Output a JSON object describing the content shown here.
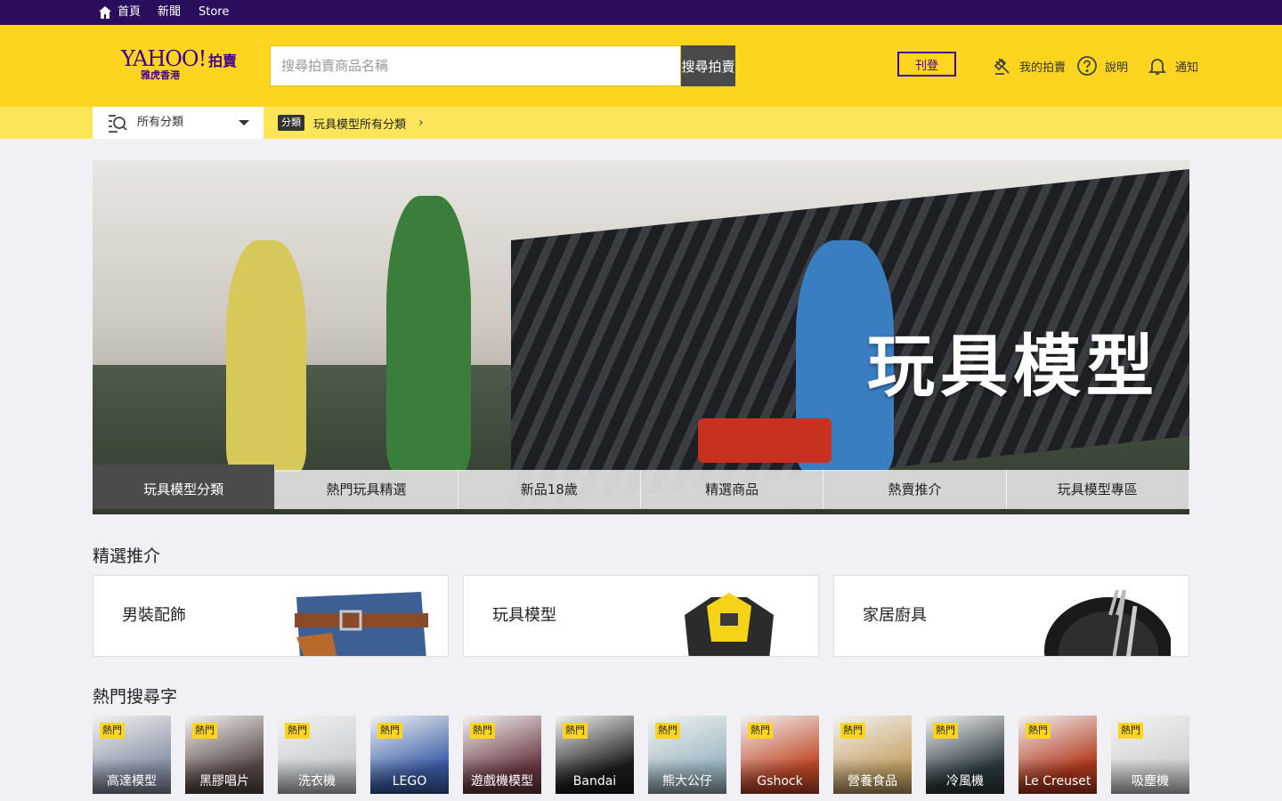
{
  "topbar": {
    "home_label": "首頁",
    "news_label": "新聞",
    "store_label": "Store"
  },
  "header": {
    "logo_text": "YAHOO!",
    "logo_auction": "拍賣",
    "logo_region": "雅虎香港",
    "search_placeholder": "搜尋拍賣商品名稱",
    "search_button": "搜尋拍賣",
    "sell_button": "刊登",
    "my_auction_label": "我的拍賣",
    "help_label": "說明",
    "notify_label": "通知"
  },
  "category_bar": {
    "select_label": "所有分類",
    "crumb_tag": "分類",
    "crumb_text": "玩具模型所有分類"
  },
  "hero": {
    "title": "玩具模型",
    "tabs": [
      "玩具模型分類",
      "熱門玩具精選",
      "新品18歲",
      "精選商品",
      "熱賣推介",
      "玩具模型專區"
    ]
  },
  "sections": {
    "featured_title": "精選推介",
    "hot_title": "熱門搜尋字"
  },
  "cards": [
    {
      "label": "男裝配飾"
    },
    {
      "label": "玩具模型"
    },
    {
      "label": "家居廚具"
    }
  ],
  "hot_badge": "熱門",
  "thumbs": [
    {
      "name": "高達模型",
      "color": "#8a93a8"
    },
    {
      "name": "黑膠唱片",
      "color": "#5a4a48"
    },
    {
      "name": "洗衣機",
      "color": "#c9cdd2"
    },
    {
      "name": "LEGO",
      "color": "#3c5fa8"
    },
    {
      "name": "遊戲機模型",
      "color": "#6c3a44"
    },
    {
      "name": "Bandai",
      "color": "#1c1c1e"
    },
    {
      "name": "熊大公仔",
      "color": "#9fb9c4"
    },
    {
      "name": "Gshock",
      "color": "#c24a2a"
    },
    {
      "name": "營養食品",
      "color": "#c7a56a"
    },
    {
      "name": "冷風機",
      "color": "#2c3a40"
    },
    {
      "name": "Le Creuset",
      "color": "#b23a1e"
    },
    {
      "name": "吸塵機",
      "color": "#d2d2d2"
    }
  ]
}
